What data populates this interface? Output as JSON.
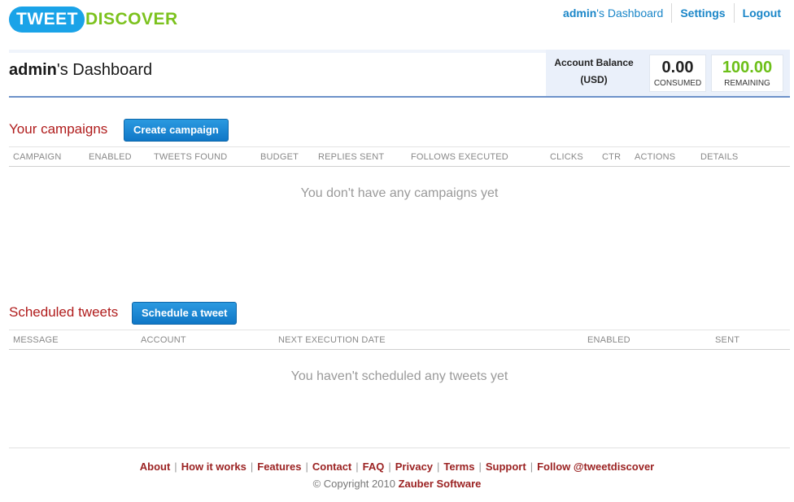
{
  "brand": {
    "part1": "TWEET",
    "part2": "DISCOVER"
  },
  "topnav": {
    "dashboard_user": "admin",
    "dashboard_suffix": "'s Dashboard",
    "settings": "Settings",
    "logout": "Logout"
  },
  "dashboard": {
    "user": "admin",
    "title_suffix": "'s Dashboard",
    "balance_label_line1": "Account Balance",
    "balance_label_line2": "(USD)",
    "consumed_value": "0.00",
    "consumed_label": "CONSUMED",
    "remaining_value": "100.00",
    "remaining_label": "REMAINING"
  },
  "campaigns": {
    "title": "Your campaigns",
    "button": "Create campaign",
    "columns": [
      "CAMPAIGN",
      "ENABLED",
      "TWEETS FOUND",
      "BUDGET",
      "REPLIES SENT",
      "FOLLOWS EXECUTED",
      "CLICKS",
      "CTR",
      "ACTIONS",
      "DETAILS"
    ],
    "empty": "You don't have any campaigns yet"
  },
  "scheduled": {
    "title": "Scheduled tweets",
    "button": "Schedule a tweet",
    "columns": [
      "MESSAGE",
      "ACCOUNT",
      "NEXT EXECUTION DATE",
      "ENABLED",
      "SENT"
    ],
    "empty": "You haven't scheduled any tweets yet"
  },
  "footer": {
    "links": [
      "About",
      "How it works",
      "Features",
      "Contact",
      "FAQ",
      "Privacy",
      "Terms",
      "Support",
      "Follow @tweetdiscover"
    ],
    "copyright_prefix": "© Copyright 2010",
    "company": "Zauber Software"
  },
  "colors": {
    "brand_blue": "#1aa3e8",
    "brand_green": "#7cc21e",
    "link_blue": "#1a86c8",
    "section_red": "#b01c1c",
    "remaining_green": "#6cbf18"
  }
}
